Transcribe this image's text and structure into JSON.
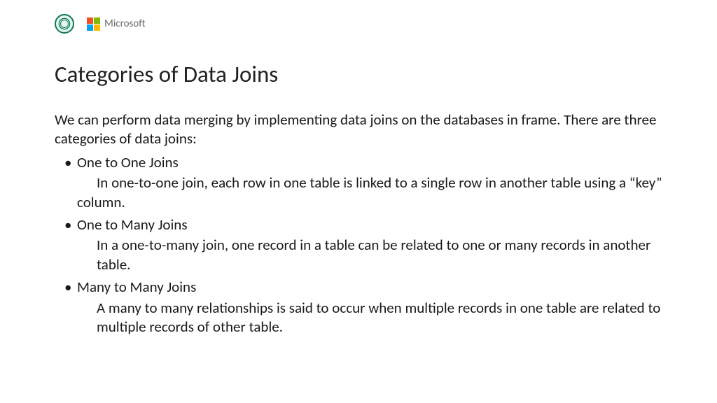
{
  "header": {
    "ms_label": "Microsoft"
  },
  "title": "Categories of Data Joins",
  "intro": "We can perform data merging by implementing data joins on the databases in frame. There are three categories of data joins:",
  "items": [
    {
      "label": "One to One Joins",
      "desc": "In one-to-one join, each row in one table is linked to a single row in another table using a “key” column."
    },
    {
      "label": "One to Many Joins",
      "desc": "In a one-to-many join, one record in a table can be related to one or many records in another table."
    },
    {
      "label": "Many to Many Joins",
      "desc": "A many to many relationships is said to occur when multiple records in one table are related to multiple records of other table."
    }
  ]
}
